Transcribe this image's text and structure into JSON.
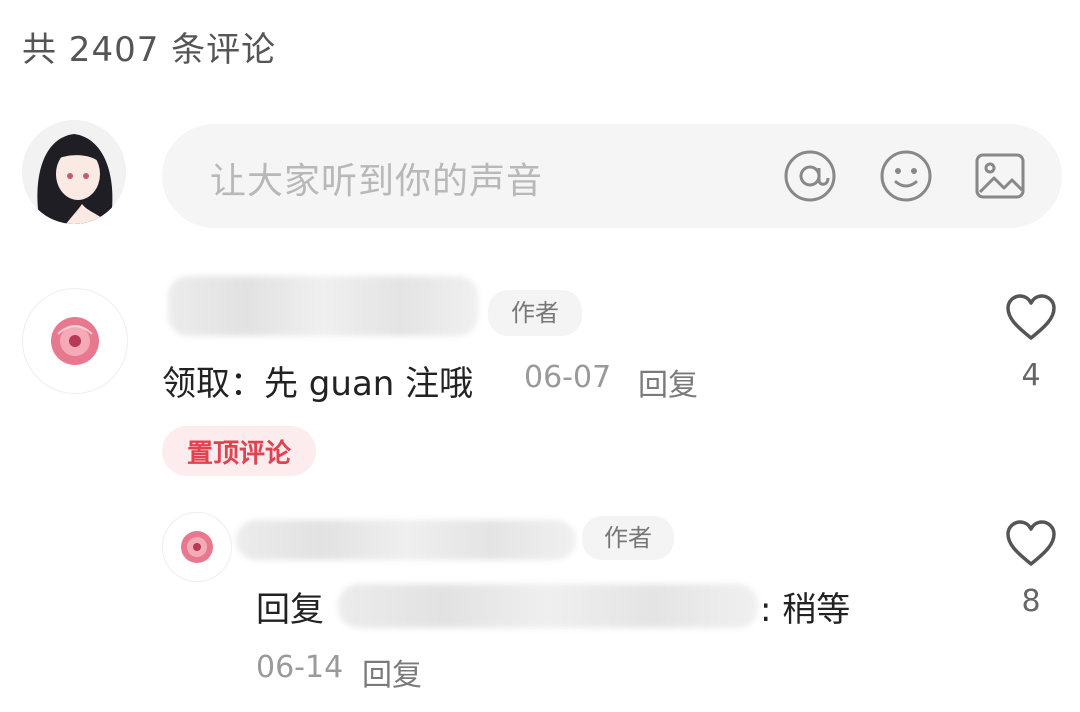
{
  "header": {
    "comment_count_title": "共 2407 条评论"
  },
  "input": {
    "placeholder": "让大家听到你的声音",
    "icons": [
      "at-icon",
      "emoji-icon",
      "image-icon"
    ]
  },
  "comments": [
    {
      "badge": "作者",
      "text": "领取：先 guan 注哦",
      "date": "06-07",
      "reply_label": "回复",
      "pinned_label": "置顶评论",
      "likes": "4",
      "replies": [
        {
          "badge": "作者",
          "reply_prefix": "回复",
          "text": ": 稍等",
          "date": "06-14",
          "reply_label": "回复",
          "likes": "8"
        }
      ]
    }
  ],
  "colors": {
    "pinned_text": "#e0424f",
    "pinned_bg": "#fdecee",
    "avatar_pink": "#e8788d"
  }
}
